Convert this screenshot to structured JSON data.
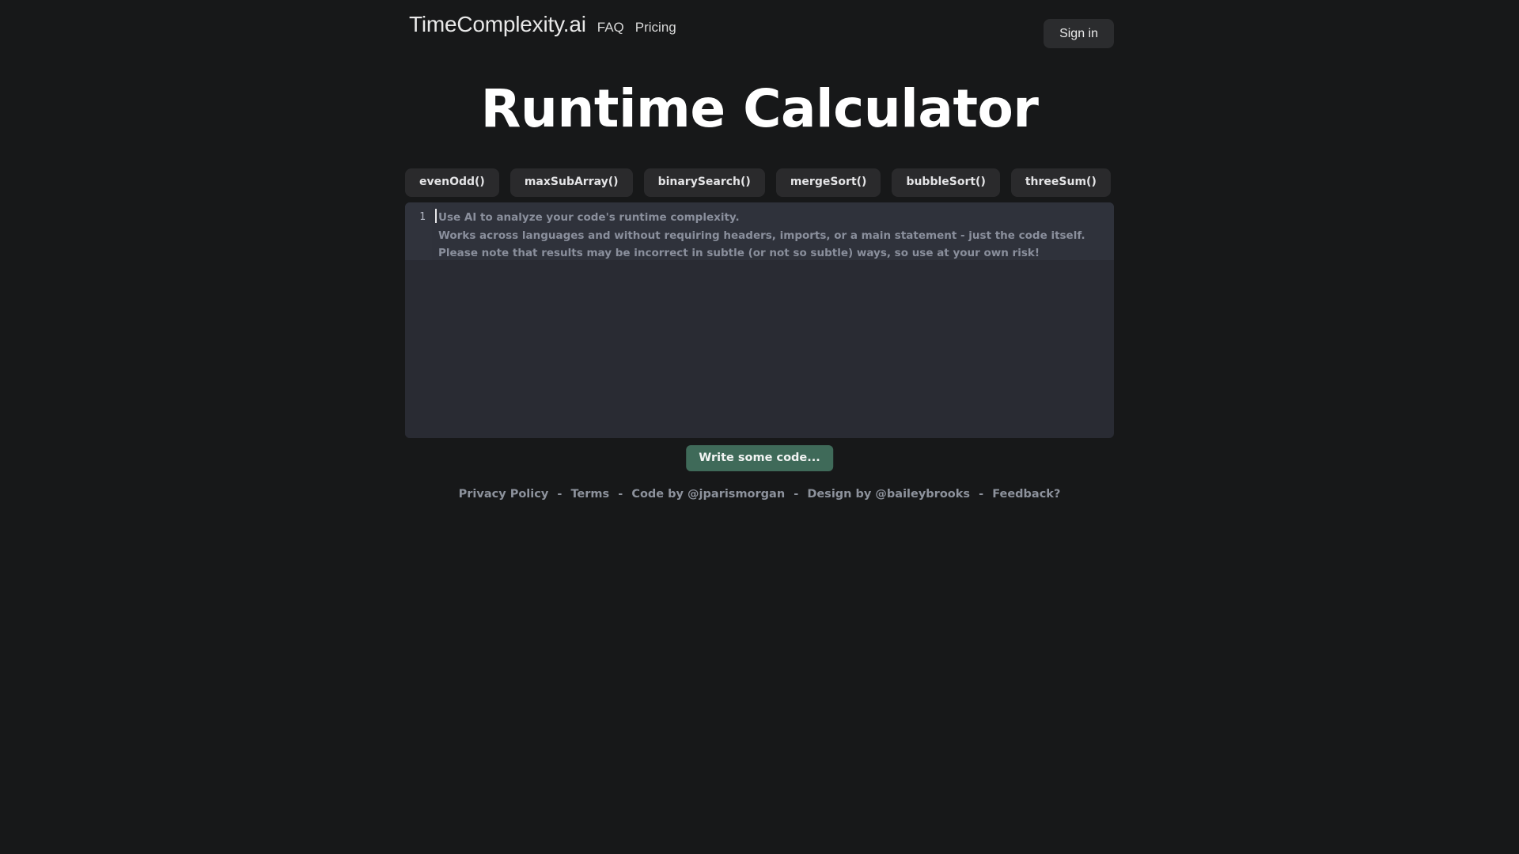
{
  "header": {
    "brand": "TimeComplexity.ai",
    "nav": [
      {
        "label": "FAQ",
        "name": "nav-faq"
      },
      {
        "label": "Pricing",
        "name": "nav-pricing"
      }
    ],
    "signin_label": "Sign in"
  },
  "main": {
    "title": "Runtime Calculator",
    "samples": [
      "evenOdd()",
      "maxSubArray()",
      "binarySearch()",
      "mergeSort()",
      "bubbleSort()",
      "threeSum()"
    ],
    "editor": {
      "line_numbers": [
        "1"
      ],
      "value": "",
      "placeholder_lines": [
        "Use AI to analyze your code's runtime complexity.",
        "Works across languages and without requiring headers, imports, or a main statement - just the code itself.",
        "Please note that results may be incorrect in subtle (or not so subtle) ways, so use at your own risk!"
      ]
    },
    "submit_label": "Write some code..."
  },
  "footer": {
    "items": [
      "Privacy Policy",
      "Terms",
      "Code by @jparismorgan",
      "Design by @baileybrooks",
      "Feedback?"
    ],
    "separator": "-"
  },
  "colors": {
    "page_bg": "#171819",
    "editor_bg": "#292b33",
    "editor_active_line": "#2f323b",
    "chip_bg": "#2a2a2c",
    "signin_bg": "#2b2c2e",
    "accent_green": "#3f6a59",
    "title_text": "#ffffff",
    "placeholder_text": "#8a8f9c",
    "footer_text": "#8d929c"
  }
}
